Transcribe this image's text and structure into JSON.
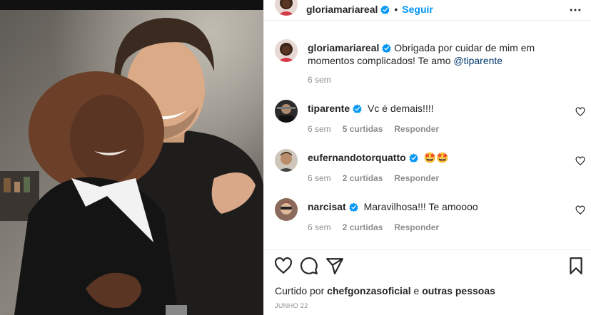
{
  "post": {
    "author": "gloriamariareal",
    "follow_label": "Seguir",
    "dot": "•",
    "caption": {
      "username": "gloriamariareal",
      "text_before": "Obrigada por cuidar de mim em momentos complicados! Te amo ",
      "mention": "@tiparente",
      "age": "6 sem"
    },
    "comments": [
      {
        "username": "tiparente",
        "text": "Vc é demais!!!!",
        "age": "6 sem",
        "likes": "5 curtidas",
        "reply": "Responder"
      },
      {
        "username": "eufernandotorquatto",
        "text": "🤩🤩",
        "age": "6 sem",
        "likes": "2 curtidas",
        "reply": "Responder"
      },
      {
        "username": "narcisat",
        "text": "Maravilhosa!!! Te amoooo",
        "age": "6 sem",
        "likes": "2 curtidas",
        "reply": "Responder"
      }
    ],
    "liked_by": {
      "prefix": "Curtido por",
      "user": "chefgonzasoficial",
      "conj": "e",
      "others": "outras pessoas"
    },
    "date": "JUNHO 22"
  },
  "colors": {
    "accent": "#0095f6",
    "text": "#262626",
    "muted": "#8e8e8e",
    "divider": "#efefef"
  },
  "icons": {
    "more": "more-horizontal-icon",
    "verified": "verified-badge-icon",
    "like": "heart-icon",
    "comment": "comment-bubble-icon",
    "share": "paper-plane-icon",
    "save": "bookmark-icon"
  }
}
